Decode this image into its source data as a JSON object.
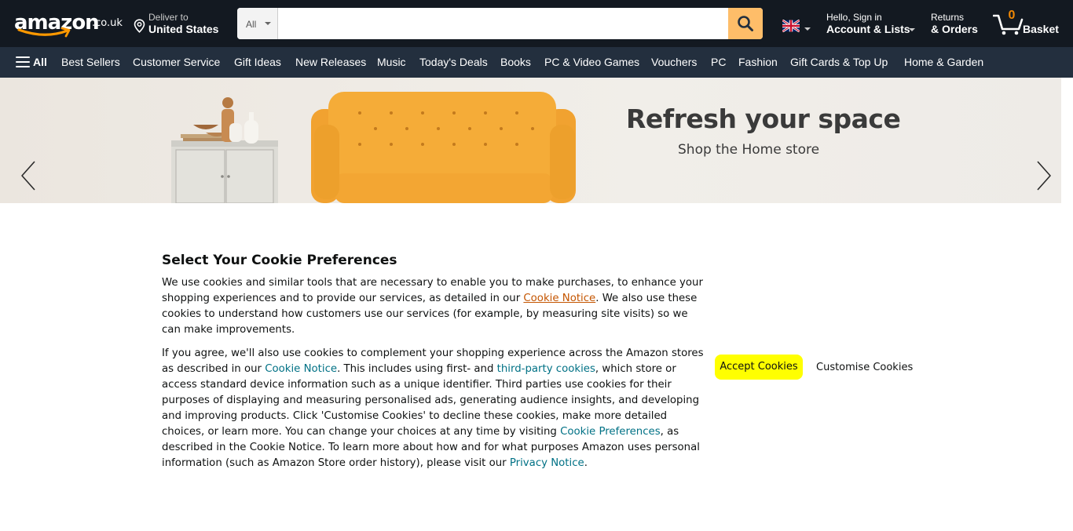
{
  "header": {
    "logo_text": "amazon",
    "logo_tld": ".co.uk",
    "deliver_line1": "Deliver to",
    "deliver_line2": "United States",
    "search_category": "All",
    "search_placeholder": "",
    "search_value": "",
    "language_flag": "uk-flag-icon",
    "account_line1": "Hello, Sign in",
    "account_line2": "Account & Lists",
    "returns_line1": "Returns",
    "returns_line2": "& Orders",
    "basket_count": "0",
    "basket_label": "Basket",
    "colors": {
      "bg": "#131921",
      "search_button": "#febd69",
      "cart_count": "#f08804"
    }
  },
  "nav": {
    "all_label": "All",
    "links": [
      "Best Sellers",
      "Customer Service",
      "Gift Ideas",
      "New Releases",
      "Music",
      "Today's Deals",
      "Books",
      "PC & Video Games",
      "Vouchers",
      "PC",
      "Fashion",
      "Gift Cards & Top Up",
      "Home & Garden"
    ],
    "colors": {
      "bg": "#232f3e"
    }
  },
  "hero": {
    "headline": "Refresh your space",
    "subline": "Shop the Home store",
    "prev_icon": "chevron-left-icon",
    "next_icon": "chevron-right-icon"
  },
  "cookie": {
    "title": "Select Your Cookie Preferences",
    "p1_a": "We use cookies and similar tools that are necessary to enable you to make purchases, to enhance your shopping experiences and to provide our services, as detailed in our ",
    "p1_link": "Cookie Notice",
    "p1_b": ". We also use these cookies to understand how customers use our services (for example, by measuring site visits) so we can make improvements.",
    "p2_a": "If you agree, we'll also use cookies to complement your shopping experience across the Amazon stores as described in our ",
    "p2_link1": "Cookie Notice",
    "p2_b": ". This includes using first- and ",
    "p2_link2": "third-party cookies",
    "p2_c": ", which store or access standard device information such as a unique identifier. Third parties use cookies for their purposes of displaying and measuring personalised ads, generating audience insights, and developing and improving products. Click 'Customise Cookies' to decline these cookies, make more detailed choices, or learn more. You can change your choices at any time by visiting ",
    "p2_link3": "Cookie Preferences",
    "p2_d": ", as described in the Cookie Notice. To learn more about how and for what purposes Amazon uses personal information (such as Amazon Store order history), please visit our ",
    "p2_link4": "Privacy Notice",
    "p2_e": ".",
    "accept_label": "Accept Cookies",
    "customise_label": "Customise Cookies",
    "colors": {
      "accept_bg": "#ffff00",
      "link": "#007185",
      "link_first": "#c45500"
    }
  }
}
